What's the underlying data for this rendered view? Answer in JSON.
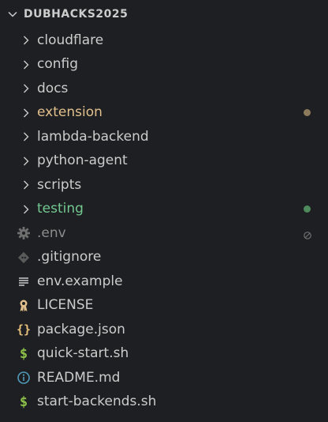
{
  "explorer": {
    "root_label": "DUBHACKS2025",
    "colors": {
      "background": "#1e1f22",
      "default_text": "#cccccc",
      "modified": "#e2c08d",
      "untracked": "#73c991",
      "ignored": "#8c8c8c",
      "modified_dot": "#8b7a5c",
      "untracked_dot": "#4e8a5c"
    },
    "folders": [
      {
        "label": "cloudflare"
      },
      {
        "label": "config"
      },
      {
        "label": "docs"
      },
      {
        "label": "extension",
        "status": "modified"
      },
      {
        "label": "lambda-backend"
      },
      {
        "label": "python-agent"
      },
      {
        "label": "scripts"
      },
      {
        "label": "testing",
        "status": "untracked"
      }
    ],
    "files": [
      {
        "label": ".env",
        "icon": "gear-icon",
        "status": "ignored"
      },
      {
        "label": ".gitignore",
        "icon": "git-icon"
      },
      {
        "label": "env.example",
        "icon": "lines-icon"
      },
      {
        "label": "LICENSE",
        "icon": "license-icon"
      },
      {
        "label": "package.json",
        "icon": "braces-icon"
      },
      {
        "label": "quick-start.sh",
        "icon": "dollar-icon"
      },
      {
        "label": "README.md",
        "icon": "info-icon"
      },
      {
        "label": "start-backends.sh",
        "icon": "dollar-icon"
      }
    ]
  }
}
